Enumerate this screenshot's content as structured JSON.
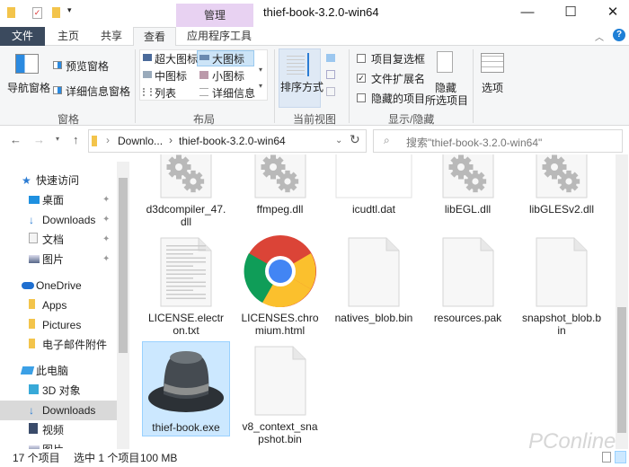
{
  "window": {
    "title": "thief-book-3.2.0-win64",
    "context_tab": "管理",
    "minimize": "—",
    "maximize": "☐",
    "close": "✕"
  },
  "tabs": [
    {
      "label": "文件"
    },
    {
      "label": "主页"
    },
    {
      "label": "共享"
    },
    {
      "label": "查看"
    },
    {
      "label": "应用程序工具"
    }
  ],
  "ribbon": {
    "panes": {
      "nav_pane": "导航窗格",
      "preview": "预览窗格",
      "details": "详细信息窗格",
      "group": "窗格"
    },
    "layout": {
      "items": [
        "超大图标",
        "大图标",
        "中图标",
        "小图标",
        "列表",
        "详细信息"
      ],
      "selected": "大图标",
      "group": "布局"
    },
    "view": {
      "sort": "排序方式",
      "group": "当前视图"
    },
    "show": {
      "item_checkboxes": "项目复选框",
      "item_checkboxes_checked": false,
      "extensions": "文件扩展名",
      "extensions_checked": true,
      "hidden_items": "隐藏的项目",
      "hidden_checked": false,
      "hide_selected_1": "隐藏",
      "hide_selected_2": "所选项目",
      "group": "显示/隐藏"
    },
    "options": "选项"
  },
  "address": {
    "crumb1": "Downlo...",
    "crumb2": "thief-book-3.2.0-win64",
    "search_placeholder": "搜索\"thief-book-3.2.0-win64\""
  },
  "nav": [
    {
      "label": "快速访问",
      "icon": "star"
    },
    {
      "label": "桌面",
      "icon": "desktop",
      "pinned": true
    },
    {
      "label": "Downloads",
      "icon": "download",
      "pinned": true
    },
    {
      "label": "文档",
      "icon": "document",
      "pinned": true
    },
    {
      "label": "图片",
      "icon": "pictures",
      "pinned": true
    },
    {
      "label": "OneDrive",
      "icon": "cloud"
    },
    {
      "label": "Apps",
      "icon": "folder"
    },
    {
      "label": "Pictures",
      "icon": "folder"
    },
    {
      "label": "电子邮件附件",
      "icon": "folder"
    },
    {
      "label": "此电脑",
      "icon": "computer"
    },
    {
      "label": "3D 对象",
      "icon": "3d"
    },
    {
      "label": "Downloads",
      "icon": "download",
      "selected": true
    },
    {
      "label": "视频",
      "icon": "video"
    },
    {
      "label": "图片",
      "icon": "pictures"
    }
  ],
  "files": [
    {
      "name": "d3dcompiler_47.dll",
      "icon": "gear"
    },
    {
      "name": "ffmpeg.dll",
      "icon": "gear"
    },
    {
      "name": "icudtl.dat",
      "icon": "dat"
    },
    {
      "name": "libEGL.dll",
      "icon": "gear"
    },
    {
      "name": "libGLESv2.dll",
      "icon": "gear"
    },
    {
      "name": "LICENSE.electron.txt",
      "icon": "text"
    },
    {
      "name": "LICENSES.chromium.html",
      "icon": "chrome"
    },
    {
      "name": "natives_blob.bin",
      "icon": "blank"
    },
    {
      "name": "resources.pak",
      "icon": "blank"
    },
    {
      "name": "snapshot_blob.bin",
      "icon": "blank"
    },
    {
      "name": "thief-book.exe",
      "icon": "hat",
      "selected": true
    },
    {
      "name": "v8_context_snapshot.bin",
      "icon": "blank"
    }
  ],
  "status": {
    "count": "17 个项目",
    "selected": "选中 1 个项目",
    "size": "100 MB"
  },
  "watermark": "PConline"
}
